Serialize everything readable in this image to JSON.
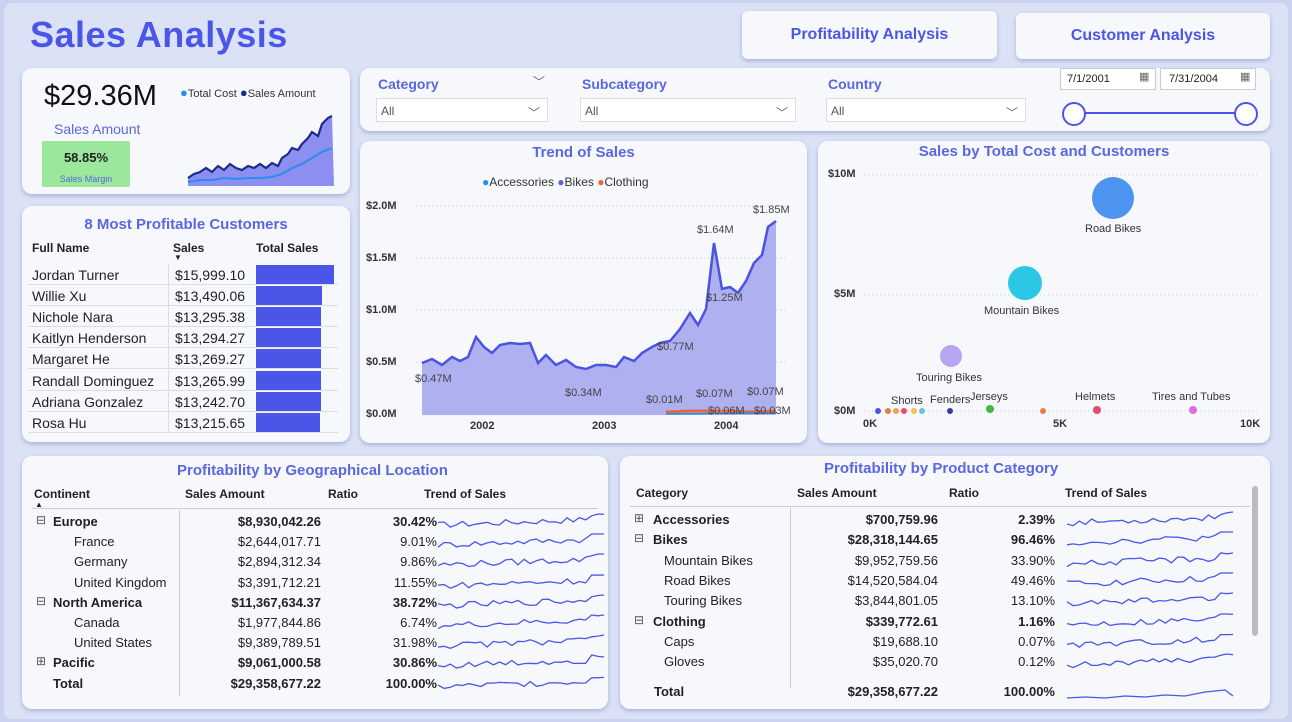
{
  "header": {
    "title": "Sales Analysis"
  },
  "nav": {
    "profitability": "Profitability Analysis",
    "customer": "Customer Analysis"
  },
  "kpi": {
    "value": "$29.36M",
    "label": "Sales Amount",
    "margin_value": "58.85%",
    "margin_label": "Sales Margin",
    "legend": [
      {
        "name": "Total Cost",
        "color": "#2b8cf0"
      },
      {
        "name": "Sales Amount",
        "color": "#1c2a8c"
      }
    ]
  },
  "slicers": {
    "category": {
      "label": "Category",
      "value": "All"
    },
    "subcategory": {
      "label": "Subcategory",
      "value": "All"
    },
    "country": {
      "label": "Country",
      "value": "All"
    },
    "date_from": "7/1/2001",
    "date_to": "7/31/2004"
  },
  "customers": {
    "title": "8 Most Profitable Customers",
    "headers": [
      "Full Name",
      "Sales",
      "Total Sales"
    ],
    "rows": [
      {
        "name": "Jordan Turner",
        "sales": "$15,999.10",
        "value": 15999.1
      },
      {
        "name": "Willie Xu",
        "sales": "$13,490.06",
        "value": 13490.06
      },
      {
        "name": "Nichole Nara",
        "sales": "$13,295.38",
        "value": 13295.38
      },
      {
        "name": "Kaitlyn Henderson",
        "sales": "$13,294.27",
        "value": 13294.27
      },
      {
        "name": "Margaret He",
        "sales": "$13,269.27",
        "value": 13269.27
      },
      {
        "name": "Randall Dominguez",
        "sales": "$13,265.99",
        "value": 13265.99
      },
      {
        "name": "Adriana Gonzalez",
        "sales": "$13,242.70",
        "value": 13242.7
      },
      {
        "name": "Rosa Hu",
        "sales": "$13,215.65",
        "value": 13215.65
      }
    ]
  },
  "trend": {
    "title": "Trend of Sales",
    "legend": [
      {
        "name": "Accessories",
        "color": "#1f8ff0"
      },
      {
        "name": "Bikes",
        "color": "#5b62e4"
      },
      {
        "name": "Clothing",
        "color": "#e8683c"
      }
    ],
    "yticks": [
      "$2.0M",
      "$1.5M",
      "$1.0M",
      "$0.5M",
      "$0.0M"
    ],
    "xticks": [
      "2002",
      "2003",
      "2004"
    ],
    "labels": [
      "$1.85M",
      "$1.64M",
      "$1.25M",
      "$0.77M",
      "$0.47M",
      "$0.34M",
      "$0.01M",
      "$0.07M",
      "$0.07M",
      "$0.06M",
      "$0.03M"
    ]
  },
  "scatter": {
    "title": "Sales by Total Cost and Customers",
    "yticks": [
      "$10M",
      "$5M",
      "$0M"
    ],
    "xticks": [
      "0K",
      "5K",
      "10K"
    ],
    "labels": [
      "Road Bikes",
      "Mountain Bikes",
      "Touring Bikes",
      "Shorts",
      "Fenders",
      "Jerseys",
      "Helmets",
      "Tires and Tubes"
    ]
  },
  "geo": {
    "title": "Profitability by Geographical Location",
    "headers": [
      "Continent",
      "Sales Amount",
      "Ratio",
      "Trend of Sales"
    ],
    "rows": [
      {
        "name": "Europe",
        "amount": "$8,930,042.26",
        "ratio": "30.42%",
        "level": 0,
        "expand": "⊟"
      },
      {
        "name": "France",
        "amount": "$2,644,017.71",
        "ratio": "9.01%",
        "level": 1,
        "expand": ""
      },
      {
        "name": "Germany",
        "amount": "$2,894,312.34",
        "ratio": "9.86%",
        "level": 1,
        "expand": ""
      },
      {
        "name": "United Kingdom",
        "amount": "$3,391,712.21",
        "ratio": "11.55%",
        "level": 1,
        "expand": ""
      },
      {
        "name": "North America",
        "amount": "$11,367,634.37",
        "ratio": "38.72%",
        "level": 0,
        "expand": "⊟"
      },
      {
        "name": "Canada",
        "amount": "$1,977,844.86",
        "ratio": "6.74%",
        "level": 1,
        "expand": ""
      },
      {
        "name": "United States",
        "amount": "$9,389,789.51",
        "ratio": "31.98%",
        "level": 1,
        "expand": ""
      },
      {
        "name": "Pacific",
        "amount": "$9,061,000.58",
        "ratio": "30.86%",
        "level": 0,
        "expand": "⊞"
      },
      {
        "name": "Total",
        "amount": "$29,358,677.22",
        "ratio": "100.00%",
        "level": 0,
        "expand": ""
      }
    ]
  },
  "product": {
    "title": "Profitability by Product Category",
    "headers": [
      "Category",
      "Sales Amount",
      "Ratio",
      "Trend of Sales"
    ],
    "rows": [
      {
        "name": "Accessories",
        "amount": "$700,759.96",
        "ratio": "2.39%",
        "level": 0,
        "expand": "⊞"
      },
      {
        "name": "Bikes",
        "amount": "$28,318,144.65",
        "ratio": "96.46%",
        "level": 0,
        "expand": "⊟"
      },
      {
        "name": "Mountain Bikes",
        "amount": "$9,952,759.56",
        "ratio": "33.90%",
        "level": 1,
        "expand": ""
      },
      {
        "name": "Road Bikes",
        "amount": "$14,520,584.04",
        "ratio": "49.46%",
        "level": 1,
        "expand": ""
      },
      {
        "name": "Touring Bikes",
        "amount": "$3,844,801.05",
        "ratio": "13.10%",
        "level": 1,
        "expand": ""
      },
      {
        "name": "Clothing",
        "amount": "$339,772.61",
        "ratio": "1.16%",
        "level": 0,
        "expand": "⊟"
      },
      {
        "name": "Caps",
        "amount": "$19,688.10",
        "ratio": "0.07%",
        "level": 1,
        "expand": ""
      },
      {
        "name": "Gloves",
        "amount": "$35,020.70",
        "ratio": "0.12%",
        "level": 1,
        "expand": ""
      }
    ],
    "total": {
      "name": "Total",
      "amount": "$29,358,677.22",
      "ratio": "100.00%"
    }
  }
}
